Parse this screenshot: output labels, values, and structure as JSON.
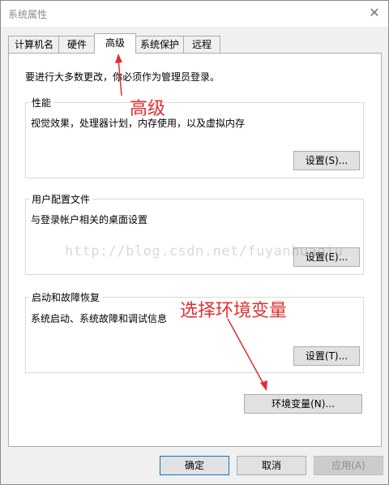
{
  "window": {
    "title": "系统属性",
    "close_glyph": "✕"
  },
  "tabs": [
    {
      "label": "计算机名",
      "active": false
    },
    {
      "label": "硬件",
      "active": false
    },
    {
      "label": "高级",
      "active": true
    },
    {
      "label": "系统保护",
      "active": false
    },
    {
      "label": "远程",
      "active": false
    }
  ],
  "panel": {
    "intro": "要进行大多数更改，你必须作为管理员登录。",
    "groups": {
      "performance": {
        "title": "性能",
        "desc": "视觉效果，处理器计划，内存使用，以及虚拟内存",
        "button": "设置(S)..."
      },
      "profiles": {
        "title": "用户配置文件",
        "desc": "与登录帐户相关的桌面设置",
        "button": "设置(E)..."
      },
      "startup": {
        "title": "启动和故障恢复",
        "desc": "系统启动、系统故障和调试信息",
        "button": "设置(T)..."
      }
    },
    "env_button": "环境变量(N)..."
  },
  "footer": {
    "ok": "确定",
    "cancel": "取消",
    "apply": "应用(A)"
  },
  "watermark": "http://blog.csdn.net/fuyanhuaqiu",
  "annotations": {
    "tab_note": "高级",
    "env_note": "选择环境变量",
    "color": "#e03030"
  }
}
